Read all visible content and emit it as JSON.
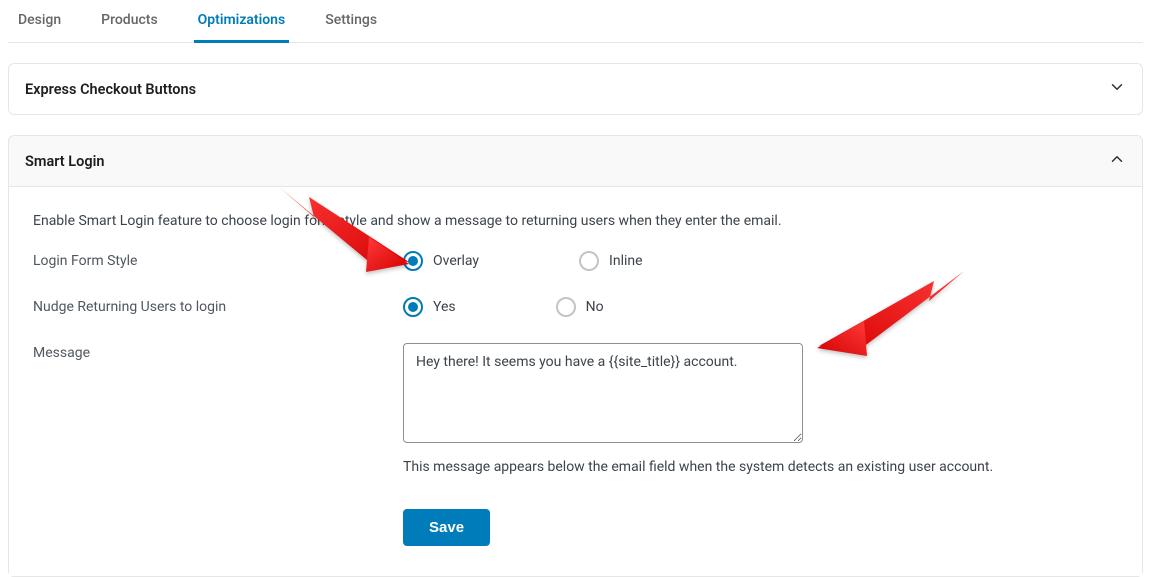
{
  "tabs": {
    "design": "Design",
    "products": "Products",
    "optimizations": "Optimizations",
    "settings": "Settings"
  },
  "panels": {
    "express_checkout": {
      "title": "Express Checkout Buttons"
    },
    "smart_login": {
      "title": "Smart Login",
      "description": "Enable Smart Login feature to choose login form style and show a message to returning users when they enter the email.",
      "fields": {
        "login_form_style": {
          "label": "Login Form Style",
          "options": {
            "overlay": "Overlay",
            "inline": "Inline"
          }
        },
        "nudge_returning": {
          "label": "Nudge Returning Users to login",
          "options": {
            "yes": "Yes",
            "no": "No"
          }
        },
        "message": {
          "label": "Message",
          "value": "Hey there! It seems you have a {{site_title}} account.",
          "helper": "This message appears below the email field when the system detects an existing user account."
        }
      },
      "save_label": "Save"
    }
  }
}
